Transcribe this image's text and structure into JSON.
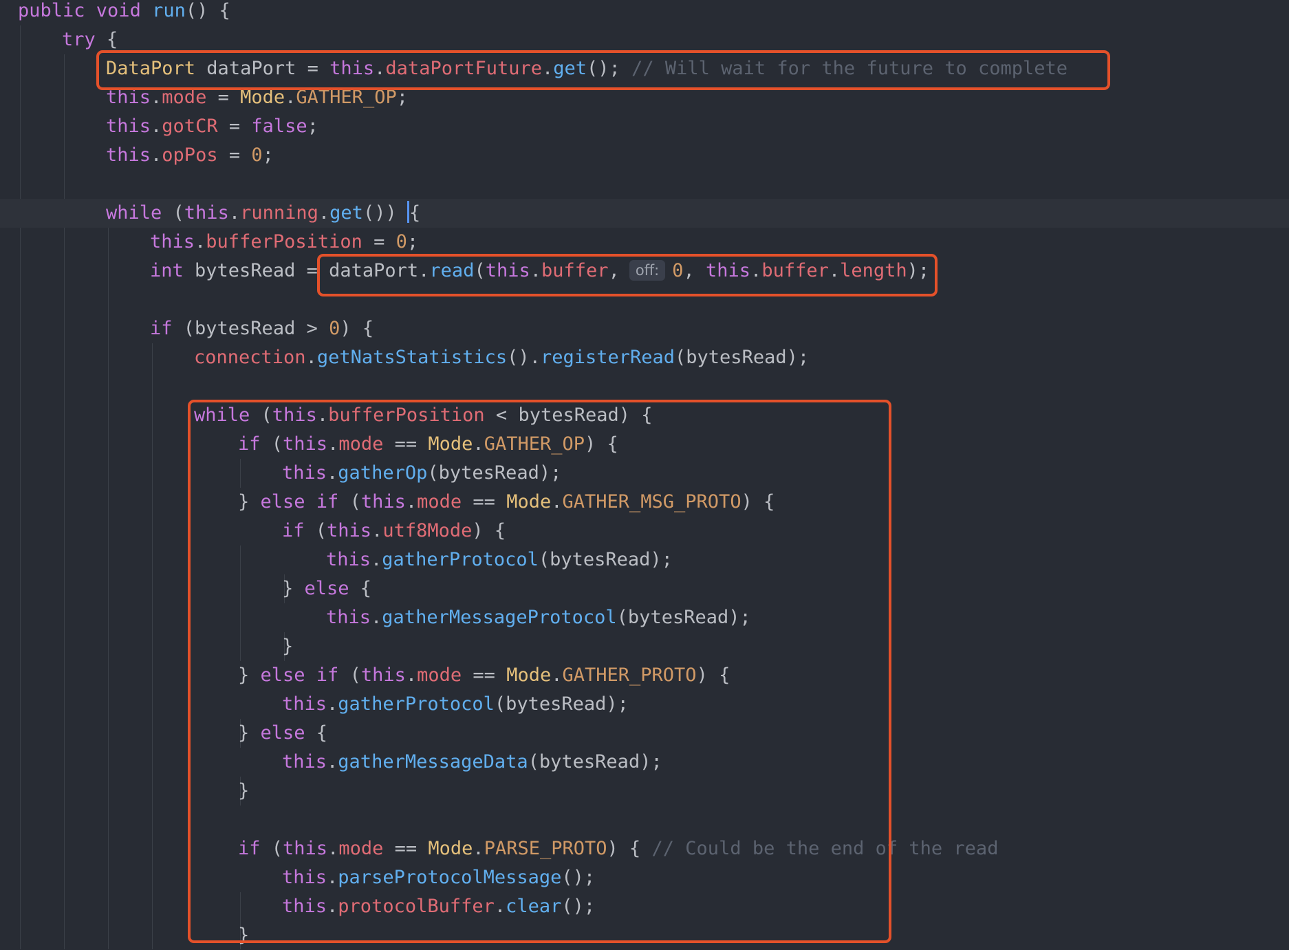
{
  "colors": {
    "background": "#282c34",
    "keyword": "#c678dd",
    "function": "#61afef",
    "type": "#e5c07b",
    "field": "#e06c75",
    "number": "#d19a66",
    "comment": "#5c6370",
    "plain": "#bbbec4",
    "highlight_box": "#e4512a"
  },
  "editor": {
    "current_line": 8,
    "highlight_boxes": [
      "dataPortFuture.get line",
      "dataPort.read call",
      "inner while loop"
    ],
    "lines": [
      {
        "indent": 0,
        "tokens": [
          {
            "t": "public ",
            "c": "k"
          },
          {
            "t": "void ",
            "c": "k"
          },
          {
            "t": "run",
            "c": "fn"
          },
          {
            "t": "() {",
            "c": "p"
          }
        ]
      },
      {
        "indent": 1,
        "tokens": [
          {
            "t": "try ",
            "c": "k"
          },
          {
            "t": "{",
            "c": "p"
          }
        ]
      },
      {
        "indent": 2,
        "tokens": [
          {
            "t": "DataPort",
            "c": "t"
          },
          {
            "t": " dataPort = ",
            "c": "p"
          },
          {
            "t": "this",
            "c": "k"
          },
          {
            "t": ".",
            "c": "p"
          },
          {
            "t": "dataPortFuture",
            "c": "f"
          },
          {
            "t": ".",
            "c": "p"
          },
          {
            "t": "get",
            "c": "fn"
          },
          {
            "t": "(); ",
            "c": "p"
          },
          {
            "t": "// Will wait for the future to complete",
            "c": "c"
          }
        ]
      },
      {
        "indent": 2,
        "tokens": [
          {
            "t": "this",
            "c": "k"
          },
          {
            "t": ".",
            "c": "p"
          },
          {
            "t": "mode",
            "c": "f"
          },
          {
            "t": " = ",
            "c": "p"
          },
          {
            "t": "Mode",
            "c": "t"
          },
          {
            "t": ".",
            "c": "p"
          },
          {
            "t": "GATHER_OP",
            "c": "n"
          },
          {
            "t": ";",
            "c": "p"
          }
        ]
      },
      {
        "indent": 2,
        "tokens": [
          {
            "t": "this",
            "c": "k"
          },
          {
            "t": ".",
            "c": "p"
          },
          {
            "t": "gotCR",
            "c": "f"
          },
          {
            "t": " = ",
            "c": "p"
          },
          {
            "t": "false",
            "c": "k"
          },
          {
            "t": ";",
            "c": "p"
          }
        ]
      },
      {
        "indent": 2,
        "tokens": [
          {
            "t": "this",
            "c": "k"
          },
          {
            "t": ".",
            "c": "p"
          },
          {
            "t": "opPos",
            "c": "f"
          },
          {
            "t": " = ",
            "c": "p"
          },
          {
            "t": "0",
            "c": "n"
          },
          {
            "t": ";",
            "c": "p"
          }
        ]
      },
      {
        "indent": 0,
        "tokens": []
      },
      {
        "indent": 2,
        "tokens": [
          {
            "t": "while",
            "c": "k"
          },
          {
            "t": " (",
            "c": "p"
          },
          {
            "t": "this",
            "c": "k"
          },
          {
            "t": ".",
            "c": "p"
          },
          {
            "t": "running",
            "c": "f"
          },
          {
            "t": ".",
            "c": "p"
          },
          {
            "t": "get",
            "c": "fn"
          },
          {
            "t": "()) {",
            "c": "p"
          }
        ],
        "caret": true
      },
      {
        "indent": 3,
        "tokens": [
          {
            "t": "this",
            "c": "k"
          },
          {
            "t": ".",
            "c": "p"
          },
          {
            "t": "bufferPosition",
            "c": "f"
          },
          {
            "t": " = ",
            "c": "p"
          },
          {
            "t": "0",
            "c": "n"
          },
          {
            "t": ";",
            "c": "p"
          }
        ]
      },
      {
        "indent": 3,
        "tokens": [
          {
            "t": "int",
            "c": "k"
          },
          {
            "t": " bytesRead = ",
            "c": "p"
          },
          {
            "t": "dataPort.",
            "c": "p"
          },
          {
            "t": "read",
            "c": "fn"
          },
          {
            "t": "(",
            "c": "p"
          },
          {
            "t": "this",
            "c": "k"
          },
          {
            "t": ".",
            "c": "p"
          },
          {
            "t": "buffer",
            "c": "f"
          },
          {
            "t": ",",
            "c": "p"
          },
          {
            "hint": "off:"
          },
          {
            "t": "0",
            "c": "n"
          },
          {
            "t": ", ",
            "c": "p"
          },
          {
            "t": "this",
            "c": "k"
          },
          {
            "t": ".",
            "c": "p"
          },
          {
            "t": "buffer",
            "c": "f"
          },
          {
            "t": ".",
            "c": "p"
          },
          {
            "t": "length",
            "c": "f"
          },
          {
            "t": ");",
            "c": "p"
          }
        ]
      },
      {
        "indent": 0,
        "tokens": []
      },
      {
        "indent": 3,
        "tokens": [
          {
            "t": "if",
            "c": "k"
          },
          {
            "t": " (bytesRead > ",
            "c": "p"
          },
          {
            "t": "0",
            "c": "n"
          },
          {
            "t": ") {",
            "c": "p"
          }
        ]
      },
      {
        "indent": 4,
        "tokens": [
          {
            "t": "connection",
            "c": "f"
          },
          {
            "t": ".",
            "c": "p"
          },
          {
            "t": "getNatsStatistics",
            "c": "fn"
          },
          {
            "t": "().",
            "c": "p"
          },
          {
            "t": "registerRead",
            "c": "fn"
          },
          {
            "t": "(bytesRead);",
            "c": "p"
          }
        ]
      },
      {
        "indent": 0,
        "tokens": []
      },
      {
        "indent": 4,
        "tokens": [
          {
            "t": "while",
            "c": "k"
          },
          {
            "t": " (",
            "c": "p"
          },
          {
            "t": "this",
            "c": "k"
          },
          {
            "t": ".",
            "c": "p"
          },
          {
            "t": "bufferPosition",
            "c": "f"
          },
          {
            "t": " < bytesRead) {",
            "c": "p"
          }
        ]
      },
      {
        "indent": 5,
        "tokens": [
          {
            "t": "if",
            "c": "k"
          },
          {
            "t": " (",
            "c": "p"
          },
          {
            "t": "this",
            "c": "k"
          },
          {
            "t": ".",
            "c": "p"
          },
          {
            "t": "mode",
            "c": "f"
          },
          {
            "t": " == ",
            "c": "p"
          },
          {
            "t": "Mode",
            "c": "t"
          },
          {
            "t": ".",
            "c": "p"
          },
          {
            "t": "GATHER_OP",
            "c": "n"
          },
          {
            "t": ") {",
            "c": "p"
          }
        ]
      },
      {
        "indent": 6,
        "tokens": [
          {
            "t": "this",
            "c": "k"
          },
          {
            "t": ".",
            "c": "p"
          },
          {
            "t": "gatherOp",
            "c": "fn"
          },
          {
            "t": "(bytesRead);",
            "c": "p"
          }
        ]
      },
      {
        "indent": 5,
        "tokens": [
          {
            "t": "} ",
            "c": "p"
          },
          {
            "t": "else if",
            "c": "k"
          },
          {
            "t": " (",
            "c": "p"
          },
          {
            "t": "this",
            "c": "k"
          },
          {
            "t": ".",
            "c": "p"
          },
          {
            "t": "mode",
            "c": "f"
          },
          {
            "t": " == ",
            "c": "p"
          },
          {
            "t": "Mode",
            "c": "t"
          },
          {
            "t": ".",
            "c": "p"
          },
          {
            "t": "GATHER_MSG_PROTO",
            "c": "n"
          },
          {
            "t": ") {",
            "c": "p"
          }
        ]
      },
      {
        "indent": 6,
        "tokens": [
          {
            "t": "if",
            "c": "k"
          },
          {
            "t": " (",
            "c": "p"
          },
          {
            "t": "this",
            "c": "k"
          },
          {
            "t": ".",
            "c": "p"
          },
          {
            "t": "utf8Mode",
            "c": "f"
          },
          {
            "t": ") {",
            "c": "p"
          }
        ]
      },
      {
        "indent": 7,
        "tokens": [
          {
            "t": "this",
            "c": "k"
          },
          {
            "t": ".",
            "c": "p"
          },
          {
            "t": "gatherProtocol",
            "c": "fn"
          },
          {
            "t": "(bytesRead);",
            "c": "p"
          }
        ]
      },
      {
        "indent": 6,
        "tokens": [
          {
            "t": "} ",
            "c": "p"
          },
          {
            "t": "else",
            "c": "k"
          },
          {
            "t": " {",
            "c": "p"
          }
        ]
      },
      {
        "indent": 7,
        "tokens": [
          {
            "t": "this",
            "c": "k"
          },
          {
            "t": ".",
            "c": "p"
          },
          {
            "t": "gatherMessageProtocol",
            "c": "fn"
          },
          {
            "t": "(bytesRead);",
            "c": "p"
          }
        ]
      },
      {
        "indent": 6,
        "tokens": [
          {
            "t": "}",
            "c": "p"
          }
        ]
      },
      {
        "indent": 5,
        "tokens": [
          {
            "t": "} ",
            "c": "p"
          },
          {
            "t": "else if",
            "c": "k"
          },
          {
            "t": " (",
            "c": "p"
          },
          {
            "t": "this",
            "c": "k"
          },
          {
            "t": ".",
            "c": "p"
          },
          {
            "t": "mode",
            "c": "f"
          },
          {
            "t": " == ",
            "c": "p"
          },
          {
            "t": "Mode",
            "c": "t"
          },
          {
            "t": ".",
            "c": "p"
          },
          {
            "t": "GATHER_PROTO",
            "c": "n"
          },
          {
            "t": ") {",
            "c": "p"
          }
        ]
      },
      {
        "indent": 6,
        "tokens": [
          {
            "t": "this",
            "c": "k"
          },
          {
            "t": ".",
            "c": "p"
          },
          {
            "t": "gatherProtocol",
            "c": "fn"
          },
          {
            "t": "(bytesRead);",
            "c": "p"
          }
        ]
      },
      {
        "indent": 5,
        "tokens": [
          {
            "t": "} ",
            "c": "p"
          },
          {
            "t": "else",
            "c": "k"
          },
          {
            "t": " {",
            "c": "p"
          }
        ]
      },
      {
        "indent": 6,
        "tokens": [
          {
            "t": "this",
            "c": "k"
          },
          {
            "t": ".",
            "c": "p"
          },
          {
            "t": "gatherMessageData",
            "c": "fn"
          },
          {
            "t": "(bytesRead);",
            "c": "p"
          }
        ]
      },
      {
        "indent": 5,
        "tokens": [
          {
            "t": "}",
            "c": "p"
          }
        ]
      },
      {
        "indent": 0,
        "tokens": []
      },
      {
        "indent": 5,
        "tokens": [
          {
            "t": "if",
            "c": "k"
          },
          {
            "t": " (",
            "c": "p"
          },
          {
            "t": "this",
            "c": "k"
          },
          {
            "t": ".",
            "c": "p"
          },
          {
            "t": "mode",
            "c": "f"
          },
          {
            "t": " == ",
            "c": "p"
          },
          {
            "t": "Mode",
            "c": "t"
          },
          {
            "t": ".",
            "c": "p"
          },
          {
            "t": "PARSE_PROTO",
            "c": "n"
          },
          {
            "t": ") { ",
            "c": "p"
          },
          {
            "t": "// Could be the end of the read",
            "c": "c"
          }
        ]
      },
      {
        "indent": 6,
        "tokens": [
          {
            "t": "this",
            "c": "k"
          },
          {
            "t": ".",
            "c": "p"
          },
          {
            "t": "parseProtocolMessage",
            "c": "fn"
          },
          {
            "t": "();",
            "c": "p"
          }
        ]
      },
      {
        "indent": 6,
        "tokens": [
          {
            "t": "this",
            "c": "k"
          },
          {
            "t": ".",
            "c": "p"
          },
          {
            "t": "protocolBuffer",
            "c": "f"
          },
          {
            "t": ".",
            "c": "p"
          },
          {
            "t": "clear",
            "c": "fn"
          },
          {
            "t": "();",
            "c": "p"
          }
        ]
      },
      {
        "indent": 5,
        "tokens": [
          {
            "t": "}",
            "c": "p"
          }
        ]
      }
    ]
  }
}
